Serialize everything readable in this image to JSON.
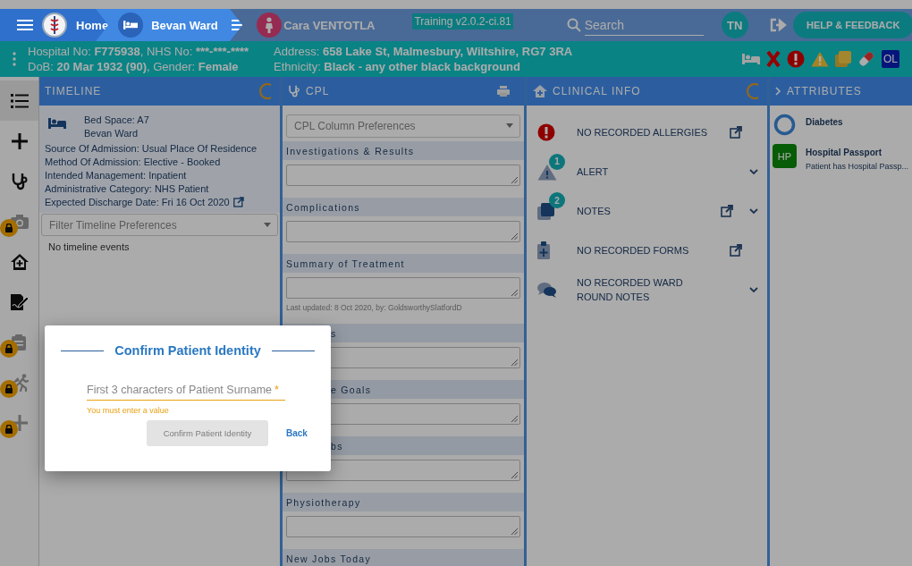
{
  "breadcrumbs": [
    {
      "label": "Home"
    },
    {
      "label": "Bevan Ward"
    },
    {
      "label": "Cara VENTOTLA"
    }
  ],
  "version_badge": "Training v2.0.2-ci.81",
  "search": {
    "placeholder": "Search"
  },
  "user_initials": "TN",
  "help_button": "HELP & FEEDBACK",
  "patient_info": {
    "left": [
      [
        {
          "label": "Hospital No: ",
          "value": "F775938"
        },
        {
          "label": ", NHS No: ",
          "value": "***-***-****"
        }
      ],
      [
        {
          "label": "DoB: ",
          "value": "20 Mar 1932 (90)"
        },
        {
          "label": ", Gender: ",
          "value": "Female"
        }
      ]
    ],
    "right": [
      [
        {
          "label": "Address: ",
          "value": "658 Lake St, Malmesbury, Wiltshire, RG7 3RA"
        }
      ],
      [
        {
          "label": "Ethnicity: ",
          "value": "Black - any other black background"
        }
      ]
    ]
  },
  "status_badge": "OL",
  "rail": [
    {
      "kind": "list",
      "selected": true,
      "locked": false
    },
    {
      "kind": "plus",
      "selected": false,
      "locked": false
    },
    {
      "kind": "stethoscope",
      "selected": false,
      "locked": false
    },
    {
      "kind": "camera",
      "selected": false,
      "locked": true
    },
    {
      "kind": "home",
      "selected": false,
      "locked": false
    },
    {
      "kind": "sign",
      "selected": false,
      "locked": false
    },
    {
      "kind": "clipboard",
      "selected": false,
      "locked": true
    },
    {
      "kind": "runner",
      "selected": false,
      "locked": true
    },
    {
      "kind": "plus",
      "selected": false,
      "locked": true
    }
  ],
  "timeline": {
    "title": "TIMELINE",
    "bed_space": "Bed Space: A7",
    "ward": "Bevan Ward",
    "details": [
      "Source Of Admission: Usual Place Of Residence",
      "Method Of Admission: Elective - Booked",
      "Intended Management: Inpatient",
      "Administrative Category: NHS Patient",
      "Expected Discharge Date: Fri 16 Oct 2020"
    ],
    "filter": {
      "placeholder": "Filter Timeline Preferences"
    },
    "empty_text": "No timeline events"
  },
  "cpl": {
    "title": "CPL",
    "preferences": {
      "placeholder": "CPL Column Preferences"
    },
    "sections": [
      {
        "label": "Investigations & Results",
        "covered": false
      },
      {
        "label": "Complications",
        "covered": false
      },
      {
        "label": "Summary of Treatment",
        "covered": false,
        "note": "Last updated: 8 Oct 2020, by: GoldsworthySlatfordD"
      },
      {
        "label": "s",
        "covered": true
      },
      {
        "label": "e Goals",
        "covered": true
      },
      {
        "label": "bs",
        "covered": true
      },
      {
        "label": "Physiotherapy",
        "covered": false
      },
      {
        "label": "New Jobs Today",
        "covered": false
      }
    ]
  },
  "clinical_info": {
    "title": "CLINICAL INFO",
    "items": [
      {
        "kind": "allergy",
        "label": "NO RECORDED ALLERGIES",
        "external": true,
        "expandable": false
      },
      {
        "kind": "alert",
        "label": "ALERT",
        "count": "1",
        "external": false,
        "expandable": true
      },
      {
        "kind": "notes",
        "label": "NOTES",
        "count": "2",
        "external": true,
        "expandable": true
      },
      {
        "kind": "forms",
        "label": "NO RECORDED FORMS",
        "external": true,
        "expandable": false
      },
      {
        "kind": "ward-round",
        "label": "NO RECORDED WARD ROUND NOTES",
        "external": false,
        "expandable": true
      }
    ]
  },
  "attributes": {
    "title": "ATTRIBUTES",
    "items": [
      {
        "kind": "ring",
        "title": "Diabetes"
      },
      {
        "kind": "badge",
        "badge": "HP",
        "title": "Hospital Passport",
        "subtitle": "Patient has Hospital Passp..."
      }
    ]
  },
  "modal": {
    "title": "Confirm Patient Identity",
    "field": {
      "placeholder": "First 3 characters of Patient Surname",
      "required_mark": "*"
    },
    "error": "You must enter a value",
    "confirm_button": {
      "label": "Confirm Patient Identity",
      "disabled": true
    },
    "back_button": "Back"
  }
}
